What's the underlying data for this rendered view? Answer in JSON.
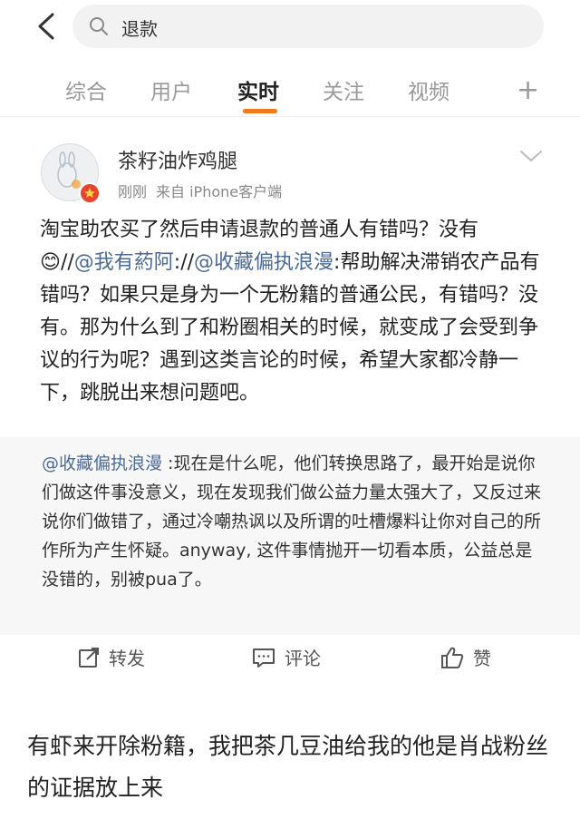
{
  "search": {
    "query": "退款"
  },
  "tabs": [
    {
      "label": "综合"
    },
    {
      "label": "用户"
    },
    {
      "label": "实时"
    },
    {
      "label": "关注"
    },
    {
      "label": "视频"
    }
  ],
  "post": {
    "username": "茶籽油炸鸡腿",
    "time": "刚刚",
    "source": "来自 iPhone客户端",
    "text_a": "淘宝助农买了然后申请退款的普通人有错吗？没有",
    "emoji": "😊",
    "text_b": "//",
    "mention_1": "@我有葯阿",
    "text_c": "://",
    "mention_2": "@收藏偏执浪漫",
    "text_d": ":帮助解决滞销农产品有错吗？如果只是身为一个无粉籍的普通公民，有错吗？没有。那为什么到了和粉圈相关的时候，就变成了会受到争议的行为呢？遇到这类言论的时候，希望大家都冷静一下，跳脱出来想问题吧。"
  },
  "repost": {
    "mention": "@收藏偏执浪漫",
    "text": " :现在是什么呢，他们转换思路了，最开始是说你们做这件事没意义，现在发现我们做公益力量太强大了，又反过来说你们做错了，通过冷嘲热讽以及所谓的吐槽爆料让你对自己的所作所为产生怀疑。anyway, 这件事情抛开一切看本质，公益总是没错的，别被pua了。"
  },
  "actions": {
    "repost_label": "转发",
    "comment_label": "评论",
    "like_label": "赞"
  },
  "caption": "有虾来开除粉籍，我把茶几豆油给我的他是肖战粉丝的证据放上来",
  "colors": {
    "accent": "#f07a1b",
    "link": "#4b6a96",
    "badge": "#e8452c"
  }
}
